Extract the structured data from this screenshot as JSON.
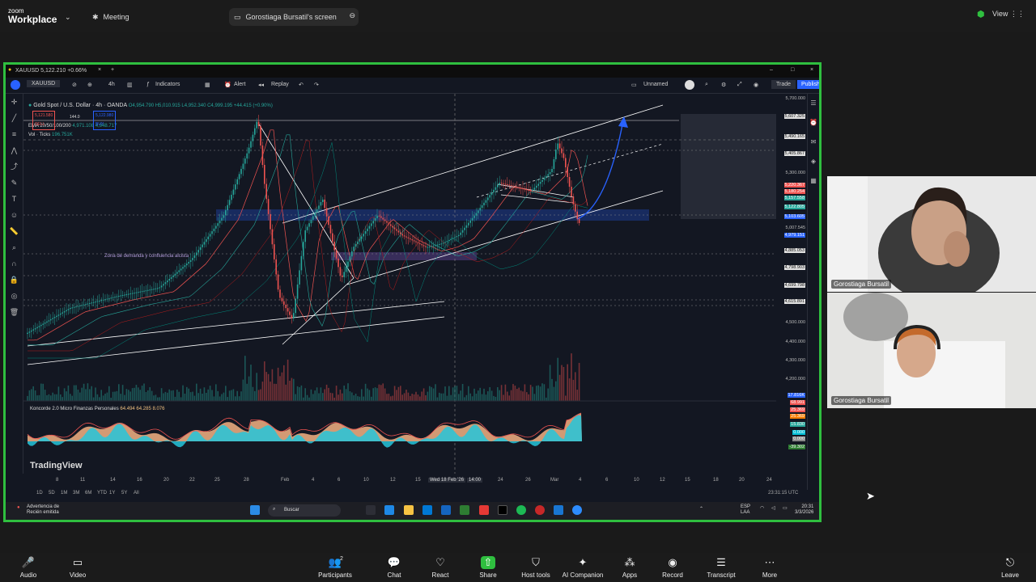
{
  "zoom": {
    "brand_top": "zoom",
    "brand_bottom": "Workplace",
    "meeting_label": "Meeting",
    "share_label": "Gorostiaga Bursatil's screen",
    "view_label": "View",
    "leave_label": "Leave"
  },
  "tradingview": {
    "window_title": "XAUUSD 5,122.210 +0.66%",
    "symbol": "XAUUSD",
    "timeframe": "4h",
    "indicators_label": "Indicators",
    "alert_label": "Alert",
    "replay_label": "Replay",
    "layout_name": "Unnamed",
    "trade_label": "Trade",
    "publish_label": "Publish",
    "chart_title": "Gold Spot / U.S. Dollar · 4h · OANDA",
    "ohlc": "O4,954.790 H5,010.915 L4,952.340 C4,999.195 +44.415 (+0.90%)",
    "sell_price": "5,121.580",
    "sell_label": "SELL",
    "spread": "144.0",
    "buy_price": "5,122.980",
    "buy_label": "BUY",
    "ema_label": "EMA 20/50/100/200",
    "ema_values": "4,971.108  4,948.717",
    "vol_label": "Vol · Ticks",
    "vol_value": "196.751K",
    "osc_label": "Koncorde 2.0 Micro Finanzas Personales",
    "osc_values": "64.494  64.285  8.076",
    "zone_label": "Zona de demanda y confluencia alcista",
    "watermark": "TradingView",
    "price_labels": [
      "5,700.000",
      "5,607.325",
      "5,490.165",
      "5,405.867",
      "5,300.000",
      "5,220.367",
      "5,180.254",
      "5,157.558",
      "5,122.805",
      "5,103.605",
      "5,007.545",
      "4,979.151",
      "4,885.053",
      "4,798.903",
      "4,699.798",
      "4,615.891",
      "4,500.000",
      "4,400.000",
      "4,300.000",
      "4,200.000"
    ],
    "osc_price_labels": [
      "17.816K",
      "68.991",
      "25.369",
      "25.369",
      "15.830",
      "0.000",
      "0.000",
      "-39.302"
    ],
    "time_labels": [
      "8",
      "11",
      "14",
      "16",
      "20",
      "22",
      "25",
      "28",
      "Feb",
      "4",
      "6",
      "10",
      "12",
      "15",
      "Wed 18 Feb '26",
      "14:00",
      "24",
      "26",
      "Mar",
      "4",
      "6",
      "10",
      "12",
      "15",
      "18",
      "20",
      "24"
    ],
    "ranges": [
      "1D",
      "5D",
      "1M",
      "3M",
      "6M",
      "YTD",
      "1Y",
      "5Y",
      "All"
    ],
    "clock": "23:31:15 UTC",
    "taskbar_search": "Buscar",
    "taskbar_notice_1": "Advertencia de",
    "taskbar_notice_2": "Recién emitida",
    "taskbar_lang": "ESP",
    "taskbar_lang2": "LAA",
    "taskbar_time": "20:31",
    "taskbar_date": "3/3/2026"
  },
  "participants": [
    {
      "name": "Gorostiaga Bursatil"
    },
    {
      "name": "Gorostiaga Bursatil"
    }
  ],
  "toolbar": [
    {
      "label": "Audio",
      "icon": "mic-icon"
    },
    {
      "label": "Video",
      "icon": "video-icon"
    },
    {
      "label": "Participants",
      "icon": "participants-icon",
      "count": "2"
    },
    {
      "label": "Chat",
      "icon": "chat-icon"
    },
    {
      "label": "React",
      "icon": "heart-icon"
    },
    {
      "label": "Share",
      "icon": "share-icon"
    },
    {
      "label": "Host tools",
      "icon": "shield-icon"
    },
    {
      "label": "AI Companion",
      "icon": "sparkle-icon"
    },
    {
      "label": "Apps",
      "icon": "apps-icon"
    },
    {
      "label": "Record",
      "icon": "record-icon"
    },
    {
      "label": "Transcript",
      "icon": "transcript-icon"
    },
    {
      "label": "More",
      "icon": "more-icon"
    }
  ],
  "colors": {
    "share_border": "#2fbf3f",
    "chart_bg": "#131722",
    "up": "#26a69a",
    "down": "#ef5350",
    "trendline": "#ffffff",
    "target_arrow": "#2962ff"
  }
}
